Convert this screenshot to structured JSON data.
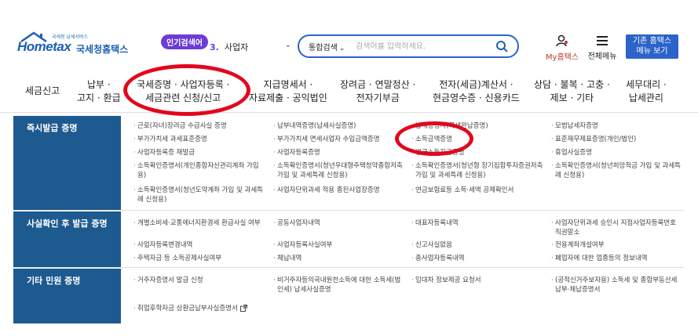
{
  "header": {
    "logo_small": "국세청 납세서비스",
    "logo_main": "Hometax",
    "logo_kor": "국세청홈택스",
    "popular_badge": "인기검색어",
    "popular_num": "3.",
    "popular_term": "사업자",
    "search_type": "통합검색",
    "search_placeholder": "검색어를 입력하세요.",
    "my_hometax": "My홈택스",
    "all_menu": "전체메뉴",
    "classic_btn_line1": "기존 홈택스",
    "classic_btn_line2": "메뉴 보기"
  },
  "gnb": [
    {
      "line1": "세금신고",
      "line2": ""
    },
    {
      "line1": "납부 ·",
      "line2": "고지 · 환급"
    },
    {
      "line1": "국세증명 · 사업자등록 ·",
      "line2": "세금관련 신청/신고"
    },
    {
      "line1": "지급명세서 ·",
      "line2": "자료제출 · 공익법인"
    },
    {
      "line1": "장려금 · 연말정산 ·",
      "line2": "전자기부금"
    },
    {
      "line1": "전자(세금)계산서 ·",
      "line2": "현금영수증 · 신용카드"
    },
    {
      "line1": "상담 · 불복 · 고충 ·",
      "line2": "제보 · 기타"
    },
    {
      "line1": "세무대리 ·",
      "line2": "납세관리"
    }
  ],
  "sections": [
    {
      "title": "즉시발급 증명",
      "cells": [
        "근로(자녀)장려금 수급사실 증명",
        "부가가치세 과세표준증명",
        "사업자등록증 재발급",
        "소득확인증명서(개인종합자산관리계좌 가입용)",
        "소득확인증명서(청년도약계좌 가입 및 과세특례 신청용)",
        "납부내역증명(납세사실증명)",
        "부가가치세 면세사업자 수입금액증명",
        "사업자등록증명",
        "소득확인증명서(청년우대형주택청약종합저축 가입 및 과세특례 신청용)",
        "사업자단위과세 적용 종된사업장증명",
        "납세증명서(국세완납증명)",
        "소득금액증명",
        "연금소득지급증명",
        "소득확인증명서(청년형 장기집합투자증권저축 가입 및 과세특례 신청용)",
        "연금보험료등 소득·세액 공제확인서",
        "모범납세자증명",
        "표준재무제표증명(개인/법인)",
        "휴업사실증명",
        "소득확인증명서(청년희망적금 가입 및 과세특례 신청용)"
      ]
    },
    {
      "title": "사실확인 후 발급 증명",
      "cells": [
        "개별소비세·교통에너지환경세 환급사실 여부",
        "사업자등록변경내역",
        "주택자금 등 소득공제사실여부",
        "공동사업자내역",
        "사업자등록사실여부",
        "체납내역",
        "대표자등록내역",
        "신고사실없음",
        "총사업자등록내역",
        "사업자단위과세 승인시 지점사업자등록번호 직권말소",
        "전용계좌개설여부",
        "폐업자에 대한 업종등의 정보내역"
      ]
    },
    {
      "title": "기타 민원 증명",
      "cells": [
        "거주자증명서 발급 신청",
        "취업후학자금 상환금납부사실증명서",
        "비거주자등의국내원천소득에 대한 소득세(법인세) 납세사실증명",
        "임대차 정보제공 요청서",
        "(공적신거주보자용) 소득세 및 종합부동산세 납부·체납증명서"
      ]
    }
  ]
}
